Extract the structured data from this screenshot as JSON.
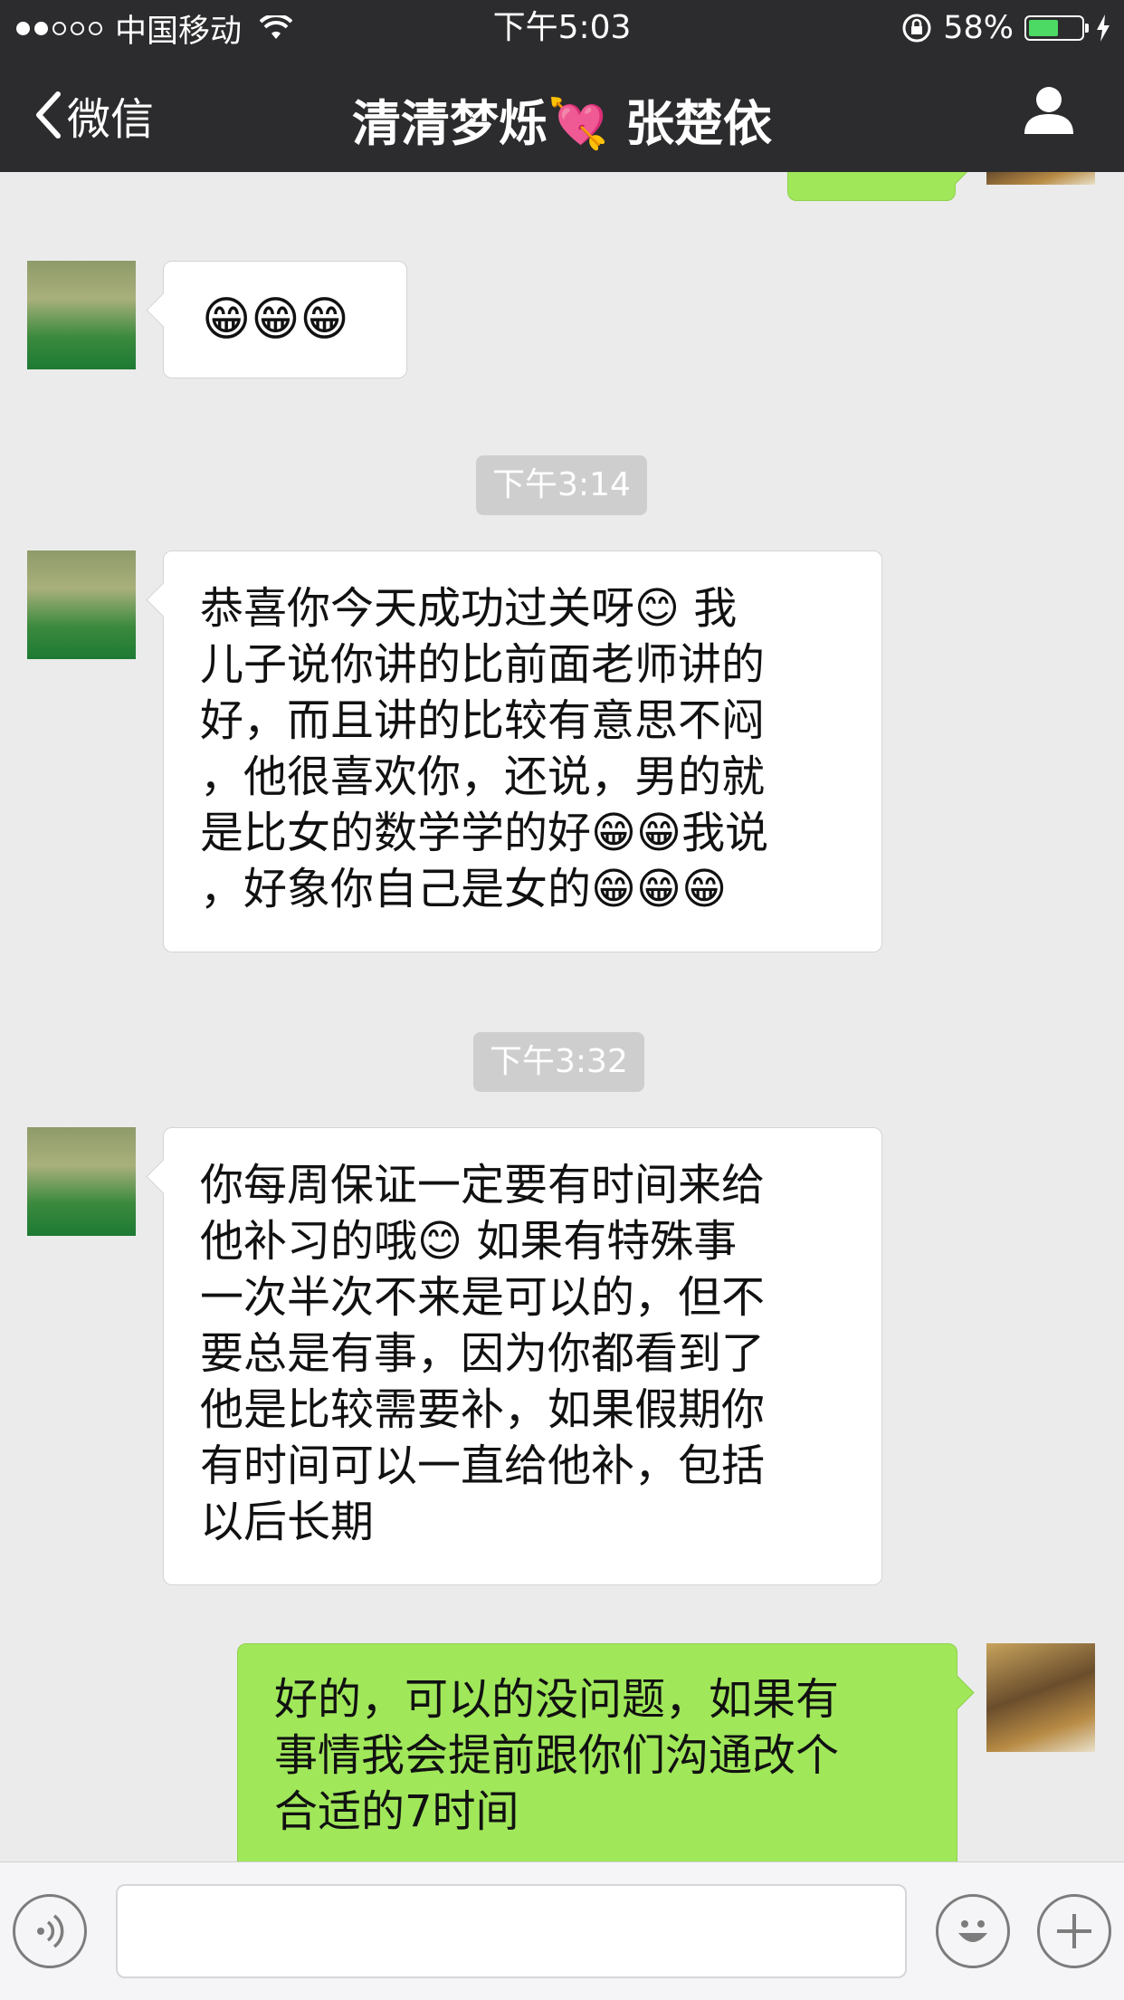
{
  "status_bar": {
    "carrier": "中国移动",
    "time": "下午5:03",
    "battery": "58%",
    "battery_level": 0.58
  },
  "nav": {
    "back_label": "微信",
    "title_left": "清清梦烁",
    "title_heart": "💘",
    "title_right": "张楚依"
  },
  "messages": [
    {
      "side": "in",
      "text": "😁😁😁"
    },
    {
      "time": "下午3:14"
    },
    {
      "side": "in",
      "lines": [
        "恭喜你今天成功过关呀😊 我",
        "儿子说你讲的比前面老师讲的",
        "好，而且讲的比较有意思不闷",
        "，他很喜欢你，还说，男的就",
        "是比女的数学学的好😁😁我说",
        "，好象你自己是女的😁😁😁"
      ]
    },
    {
      "time": "下午3:32"
    },
    {
      "side": "in",
      "lines": [
        "你每周保证一定要有时间来给",
        "他补习的哦😊 如果有特殊事",
        "一次半次不来是可以的，但不",
        "要总是有事，因为你都看到了",
        "他是比较需要补，如果假期你",
        "有时间可以一直给他补，包括",
        "以后长期"
      ]
    },
    {
      "side": "out",
      "lines": [
        "好的，可以的没问题，如果有",
        "事情我会提前跟你们沟通改个",
        "合适的7时间"
      ]
    }
  ],
  "input": {
    "placeholder": ""
  },
  "icons": {
    "voice": "voice-icon",
    "emoji": "emoji-icon",
    "plus": "plus-icon"
  }
}
